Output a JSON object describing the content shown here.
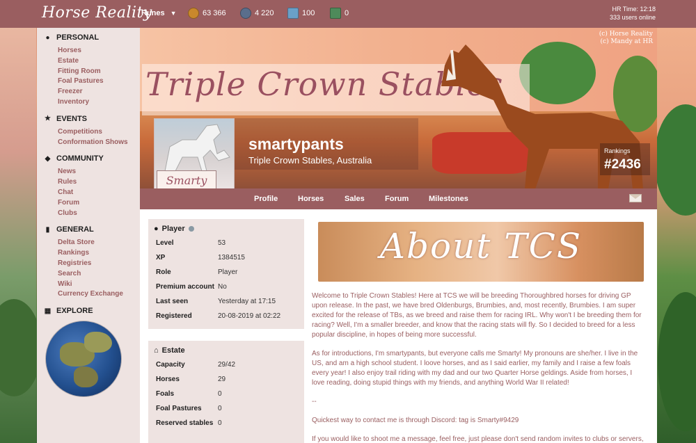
{
  "topbar": {
    "logo": "Horse Reality",
    "runes_label": "Runes",
    "currencies": [
      {
        "name": "gold-coin-icon",
        "value": "63 366",
        "color": "#c9882c"
      },
      {
        "name": "horse-token-icon",
        "value": "4 220",
        "color": "#5a6e8c"
      },
      {
        "name": "pass-ticket-icon",
        "value": "100",
        "color": "#6aa0c8"
      },
      {
        "name": "cash-icon",
        "value": "0",
        "color": "#4e8a5a"
      }
    ],
    "hr_time": "HR Time: 12:18",
    "users_online": "333 users online"
  },
  "sidebar": {
    "sections": [
      {
        "title": "PERSONAL",
        "icon": "user-icon",
        "items": [
          "Horses",
          "Estate",
          "Fitting Room",
          "Foal Pastures",
          "Freezer",
          "Inventory"
        ]
      },
      {
        "title": "EVENTS",
        "icon": "star-icon",
        "items": [
          "Competitions",
          "Conformation Shows"
        ]
      },
      {
        "title": "COMMUNITY",
        "icon": "chat-icon",
        "items": [
          "News",
          "Rules",
          "Chat",
          "Forum",
          "Clubs"
        ]
      },
      {
        "title": "GENERAL",
        "icon": "bookmark-icon",
        "items": [
          "Delta Store",
          "Rankings",
          "Registries",
          "Search",
          "Wiki",
          "Currency Exchange"
        ]
      },
      {
        "title": "EXPLORE",
        "icon": "map-icon",
        "items": []
      }
    ]
  },
  "banner": {
    "stable_script": "Triple Crown Stables",
    "copyright_1": "(c) Horse Reality",
    "copyright_2": "(c) Mandy at HR",
    "avatar_name": "Smarty",
    "username": "smartypants",
    "location": "Triple Crown Stables, Australia",
    "rankings_label": "Rankings",
    "ranking_value": "#2436"
  },
  "nav": {
    "items": [
      "Profile",
      "Horses",
      "Sales",
      "Forum",
      "Milestones"
    ]
  },
  "player_card": {
    "title": "Player",
    "rows": [
      {
        "k": "Level",
        "v": "53"
      },
      {
        "k": "XP",
        "v": "1384515"
      },
      {
        "k": "Role",
        "v": "Player"
      },
      {
        "k": "Premium account",
        "v": "No"
      },
      {
        "k": "Last seen",
        "v": "Yesterday at 17:15"
      },
      {
        "k": "Registered",
        "v": "20-08-2019 at 02:22"
      }
    ]
  },
  "estate_card": {
    "title": "Estate",
    "rows": [
      {
        "k": "Capacity",
        "v": "29/42"
      },
      {
        "k": "Horses",
        "v": "29"
      },
      {
        "k": "Foals",
        "v": "0"
      },
      {
        "k": "Foal Pastures",
        "v": "0"
      },
      {
        "k": "Reserved stables",
        "v": "0"
      }
    ]
  },
  "about": {
    "banner_text": "About TCS",
    "paragraphs": [
      "Welcome to Triple Crown Stables! Here at TCS we will be breeding Thoroughbred horses for driving GP upon release. In the past, we have bred Oldenburgs, Brumbies, and, most recently, Brumbies. I am super excited for the release of TBs, as we breed and raise them for racing IRL. Why won't I be breeding them for racing? Well, I'm a smaller breeder, and know that the racing stats will fly. So I decided to breed for a less popular discipline, in hopes of being more successful.",
      "As for introductions, I'm smartypants, but everyone calls me Smarty! My pronouns are she/her. I live in the US, and am a high school student. I loove horses, and as I said earlier, my family and I raise a few foals every year! I also enjoy trail riding with my dad and our two Quarter Horse geldings. Aside from horses, I love reading, doing stupid things with my friends, and anything World War II related!",
      "--",
      "Quickest way to contact me is through Discord: tag is Smarty#9429",
      "If you would like to shoot me a message, feel free, just please don't send random invites to clubs or servers,"
    ]
  }
}
